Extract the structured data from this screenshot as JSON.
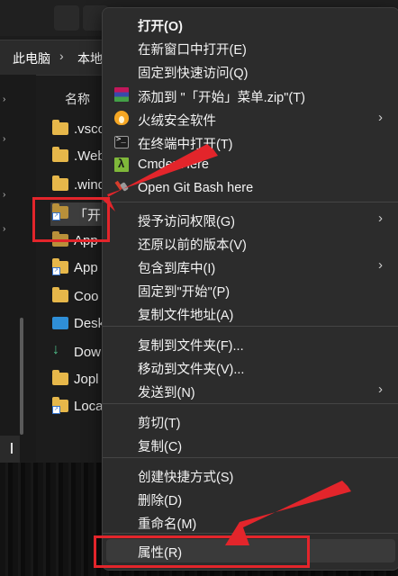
{
  "explorer": {
    "breadcrumb": [
      "此电脑",
      "本地"
    ],
    "column_name": "名称",
    "files": [
      {
        "name": ".vsco",
        "type": "folder"
      },
      {
        "name": ".Web",
        "type": "folder"
      },
      {
        "name": ".wind",
        "type": "folder"
      },
      {
        "name": "「开",
        "type": "folder-shortcut"
      },
      {
        "name": "App",
        "type": "folder"
      },
      {
        "name": "App",
        "type": "folder-shortcut"
      },
      {
        "name": "Coo",
        "type": "folder"
      },
      {
        "name": "Desk",
        "type": "desktop"
      },
      {
        "name": "Dow",
        "type": "download"
      },
      {
        "name": "Jopl",
        "type": "folder"
      },
      {
        "name": "Loca",
        "type": "folder-shortcut"
      }
    ]
  },
  "menu": {
    "groups": [
      [
        {
          "label": "打开(O)",
          "icon": "",
          "bold": true,
          "submenu": false
        },
        {
          "label": "在新窗口中打开(E)",
          "icon": "",
          "bold": false,
          "submenu": false
        },
        {
          "label": "固定到快速访问(Q)",
          "icon": "",
          "bold": false,
          "submenu": false
        },
        {
          "label": "添加到 \"「开始」菜单.zip\"(T)",
          "icon": "winrar-icon",
          "bold": false,
          "submenu": false
        },
        {
          "label": "火绒安全软件",
          "icon": "huorong-icon",
          "bold": false,
          "submenu": true
        },
        {
          "label": "在终端中打开(T)",
          "icon": "terminal-icon",
          "bold": false,
          "submenu": false
        },
        {
          "label": "Cmder Here",
          "icon": "cmder-icon",
          "bold": false,
          "submenu": false
        },
        {
          "label": "Open Git Bash here",
          "icon": "git-bash-icon",
          "bold": false,
          "submenu": false
        }
      ],
      [
        {
          "label": "授予访问权限(G)",
          "icon": "",
          "bold": false,
          "submenu": true
        },
        {
          "label": "还原以前的版本(V)",
          "icon": "",
          "bold": false,
          "submenu": false
        },
        {
          "label": "包含到库中(I)",
          "icon": "",
          "bold": false,
          "submenu": true
        },
        {
          "label": "固定到\"开始\"(P)",
          "icon": "",
          "bold": false,
          "submenu": false
        },
        {
          "label": "复制文件地址(A)",
          "icon": "",
          "bold": false,
          "submenu": false
        }
      ],
      [
        {
          "label": "复制到文件夹(F)...",
          "icon": "",
          "bold": false,
          "submenu": false
        },
        {
          "label": "移动到文件夹(V)...",
          "icon": "",
          "bold": false,
          "submenu": false
        },
        {
          "label": "发送到(N)",
          "icon": "",
          "bold": false,
          "submenu": true
        }
      ],
      [
        {
          "label": "剪切(T)",
          "icon": "",
          "bold": false,
          "submenu": false
        },
        {
          "label": "复制(C)",
          "icon": "",
          "bold": false,
          "submenu": false
        }
      ],
      [
        {
          "label": "创建快捷方式(S)",
          "icon": "",
          "bold": false,
          "submenu": false
        },
        {
          "label": "删除(D)",
          "icon": "",
          "bold": false,
          "submenu": false
        },
        {
          "label": "重命名(M)",
          "icon": "",
          "bold": false,
          "submenu": false
        }
      ],
      [
        {
          "label": "属性(R)",
          "icon": "",
          "bold": false,
          "submenu": false,
          "hovered": true
        }
      ]
    ]
  },
  "colors": {
    "menu_bg": "#2c2c2c",
    "highlight_red": "#e3252b",
    "folder_yellow": "#e6b74a"
  }
}
